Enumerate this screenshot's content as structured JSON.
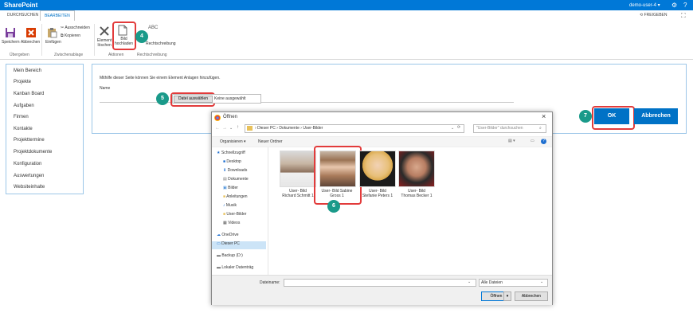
{
  "suitebar": {
    "brand": "SharePoint",
    "user": "demo-user-4 ▾",
    "settings_icon": "⚙",
    "help_icon": "?"
  },
  "tabs": [
    {
      "label": "DURCHSUCHEN"
    },
    {
      "label": "BEARBEITEN"
    }
  ],
  "share": {
    "label": "FREIGEBEN"
  },
  "ribbon": {
    "save": "Speichern",
    "cancel": "Abbrechen",
    "group_commit": "Übergeben",
    "paste": "Einfügen",
    "cut": "Ausschneiden",
    "copy": "Kopieren",
    "group_clipboard": "Zwischenablage",
    "delete_l1": "Element",
    "delete_l2": "löschen",
    "upload_l1": "Bild",
    "upload_l2": "hochladen",
    "group_actions": "Aktionen",
    "spelling": "Rechtschreibung",
    "spelling_icon": "ABC",
    "group_spelling": "Rechtschreibung"
  },
  "nav": {
    "items": [
      {
        "label": "Mein Bereich"
      },
      {
        "label": "Projekte"
      },
      {
        "label": "Kanban Board"
      },
      {
        "label": "Aufgaben"
      },
      {
        "label": "Firmen"
      },
      {
        "label": "Kontakte"
      },
      {
        "label": "Projekttermine"
      },
      {
        "label": "Projektdokumente"
      },
      {
        "label": "Konfiguration"
      },
      {
        "label": "Auswertungen"
      },
      {
        "label": "Websiteinhalte"
      }
    ]
  },
  "form": {
    "hint": "Mithilfe dieser Seite können Sie einem Element Anlagen hinzufügen.",
    "name_label": "Name",
    "choose_file": "Datei auswählen",
    "no_file": "Keine ausgewählt",
    "ok": "OK",
    "cancel": "Abbrechen"
  },
  "badges": {
    "b4": "4",
    "b5": "5",
    "b6": "6",
    "b7": "7"
  },
  "dialog": {
    "title": "Öffnen",
    "close": "×",
    "path": [
      "Dieser PC",
      "Dokumente",
      "User-Bilder"
    ],
    "search_placeholder": "\"User-Bilder\" durchsuchen",
    "organize": "Organisieren ▾",
    "new_folder": "Neuer Ordner",
    "tree": [
      {
        "label": "Schnellzugriff"
      },
      {
        "label": "Desktop"
      },
      {
        "label": "Downloads"
      },
      {
        "label": "Dokumente"
      },
      {
        "label": "Bilder"
      },
      {
        "label": "Anleitungen"
      },
      {
        "label": "Musik"
      },
      {
        "label": "User-Bilder"
      },
      {
        "label": "Videos"
      },
      {
        "label": "OneDrive"
      },
      {
        "label": "Dieser PC"
      },
      {
        "label": "Backup (D:)"
      },
      {
        "label": "Lokaler Datenträg"
      }
    ],
    "files": [
      {
        "line1": "User- Bild",
        "line2": "Richard Schmitt 1"
      },
      {
        "line1": "User- Bild Sabine",
        "line2": "Gross 1"
      },
      {
        "line1": "User- Bild",
        "line2": "Stefanie Peters 1"
      },
      {
        "line1": "User- Bild",
        "line2": "Thomas Becker 1"
      }
    ],
    "filename_label": "Dateiname:",
    "filter": "Alle Dateien",
    "open": "Öffnen",
    "cancel": "Abbrechen"
  }
}
